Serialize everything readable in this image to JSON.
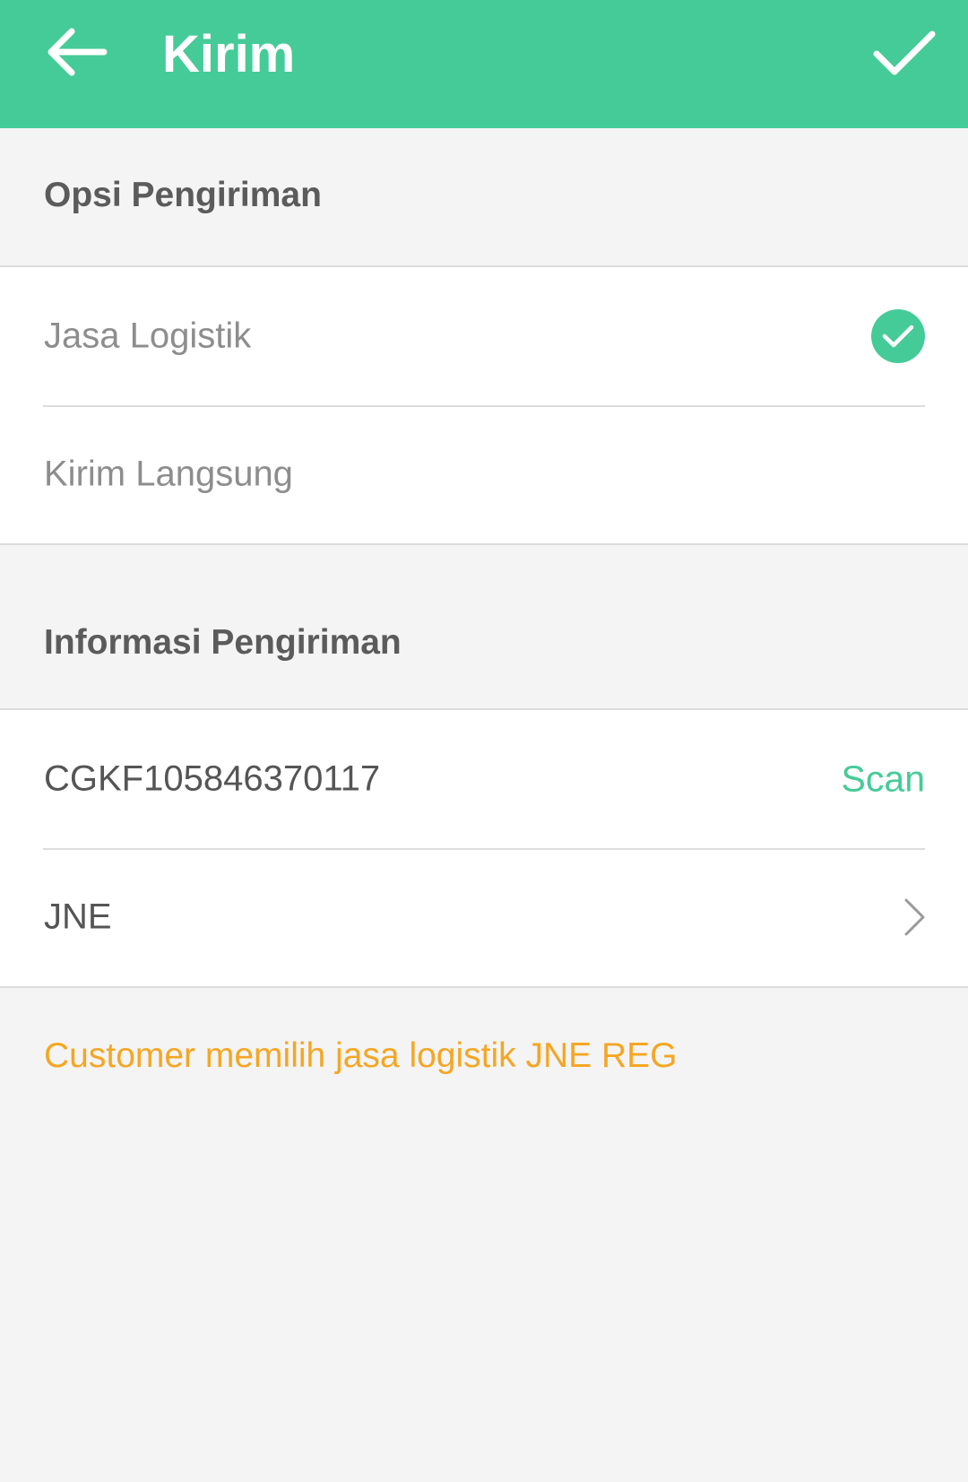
{
  "appbar": {
    "title": "Kirim",
    "back_icon": "arrow-left-icon",
    "confirm_icon": "checkmark-icon",
    "color": "#45cb98"
  },
  "shipping_options": {
    "header": "Opsi Pengiriman",
    "items": [
      {
        "label": "Jasa Logistik",
        "selected": true
      },
      {
        "label": "Kirim Langsung",
        "selected": false
      }
    ]
  },
  "shipping_info": {
    "header": "Informasi Pengiriman",
    "tracking_number": "CGKF105846370117",
    "scan_label": "Scan",
    "courier": "JNE"
  },
  "note": {
    "text": "Customer memilih jasa logistik JNE REG",
    "color": "#f5a623"
  }
}
